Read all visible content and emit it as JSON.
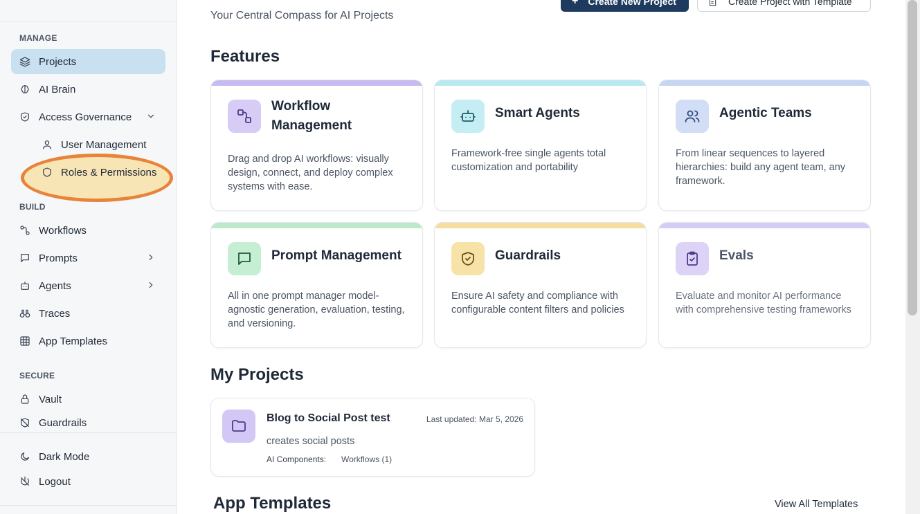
{
  "sidebar": {
    "sections": {
      "manage": "MANAGE",
      "build": "BUILD",
      "secure": "SECURE"
    },
    "items": {
      "projects": "Projects",
      "ai_brain": "AI Brain",
      "access_governance": "Access Governance",
      "user_management": "User Management",
      "roles_permissions": "Roles & Permissions",
      "workflows": "Workflows",
      "prompts": "Prompts",
      "agents": "Agents",
      "traces": "Traces",
      "app_templates": "App Templates",
      "vault": "Vault",
      "guardrails": "Guardrails",
      "dark_mode": "Dark Mode",
      "logout": "Logout"
    },
    "active_item": "projects",
    "highlight_color": "#e8843a"
  },
  "header": {
    "subtitle": "Your Central Compass for AI Projects",
    "create_new_label": "Create New Project",
    "create_template_label": "Create Project with Template"
  },
  "features": {
    "title": "Features",
    "cards": [
      {
        "title": "Workflow Management",
        "desc": "Drag and drop AI workflows: visually design, connect, and deploy complex systems with ease.",
        "accent": "#c7baf2",
        "icon": "workflow-icon"
      },
      {
        "title": "Smart Agents",
        "desc": "Framework-free single agents total customization and portability",
        "accent": "#b8e9f0",
        "icon": "bot-icon"
      },
      {
        "title": "Agentic Teams",
        "desc": "From linear sequences to layered hierarchies: build any agent team, any framework.",
        "accent": "#c5d6f2",
        "icon": "users-icon"
      },
      {
        "title": "Prompt Management",
        "desc": "All in one prompt manager model-agnostic generation, evaluation, testing, and versioning.",
        "accent": "#bde8c9",
        "icon": "message-icon"
      },
      {
        "title": "Guardrails",
        "desc": "Ensure AI safety and compliance with configurable content filters and policies",
        "accent": "#f5dd9f",
        "icon": "shield-check-icon"
      },
      {
        "title": "Evals",
        "desc": "Evaluate and monitor AI performance with comprehensive testing frameworks",
        "accent": "#d6cdf5",
        "icon": "clipboard-check-icon"
      }
    ]
  },
  "my_projects": {
    "title": "My Projects",
    "projects": [
      {
        "name": "Blog to Social Post test",
        "updated": "Last updated: Mar 5, 2026",
        "description": "creates social posts",
        "components_label": "AI Components:",
        "components_value": "Workflows (1)"
      }
    ]
  },
  "app_templates": {
    "title": "App Templates",
    "view_all": "View All Templates"
  }
}
